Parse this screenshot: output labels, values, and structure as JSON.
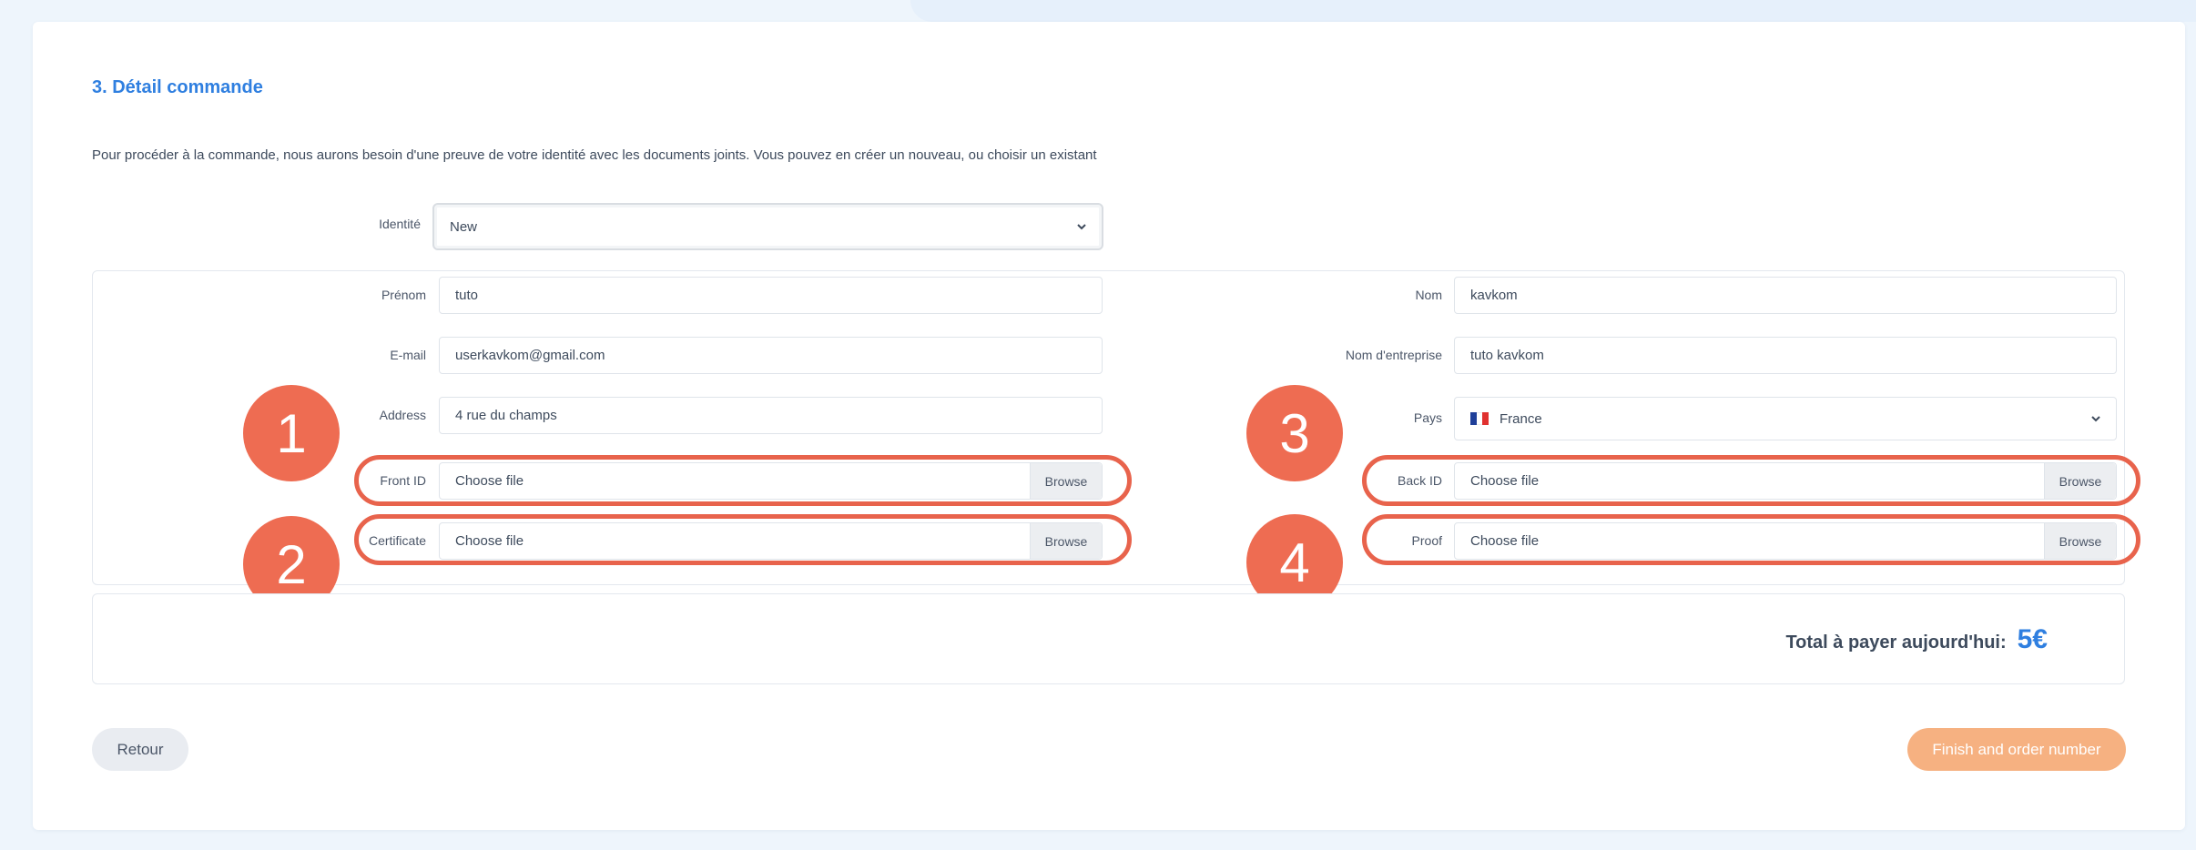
{
  "section": {
    "title": "3. Détail commande",
    "intro": "Pour procéder à la commande, nous aurons besoin d'une preuve de votre identité avec les documents joints. Vous pouvez en créer un nouveau, ou choisir un existant"
  },
  "identity": {
    "label": "Identité",
    "value": "New"
  },
  "form": {
    "first_name": {
      "label": "Prénom",
      "value": "tuto"
    },
    "last_name": {
      "label": "Nom",
      "value": "kavkom"
    },
    "email": {
      "label": "E-mail",
      "value": "userkavkom@gmail.com"
    },
    "company": {
      "label": "Nom d'entreprise",
      "value": "tuto kavkom"
    },
    "address": {
      "label": "Address",
      "value": "4 rue du champs"
    },
    "country": {
      "label": "Pays",
      "value": "France",
      "flag_colors": [
        "#1f3f99",
        "#ffffff",
        "#e0312f"
      ]
    },
    "front_id": {
      "label": "Front ID",
      "value": "Choose file",
      "browse": "Browse"
    },
    "back_id": {
      "label": "Back ID",
      "value": "Choose file",
      "browse": "Browse"
    },
    "certificate": {
      "label": "Certificate",
      "value": "Choose file",
      "browse": "Browse"
    },
    "proof": {
      "label": "Proof",
      "value": "Choose file",
      "browse": "Browse"
    }
  },
  "annotations": [
    "1",
    "2",
    "3",
    "4"
  ],
  "annotation_color": "#ee6c52",
  "total": {
    "label": "Total à payer aujourd'hui:",
    "value": "5€"
  },
  "buttons": {
    "back": "Retour",
    "finish": "Finish and order number"
  },
  "colors": {
    "accent": "#2f7fe0",
    "finish_button": "#f6b181"
  }
}
